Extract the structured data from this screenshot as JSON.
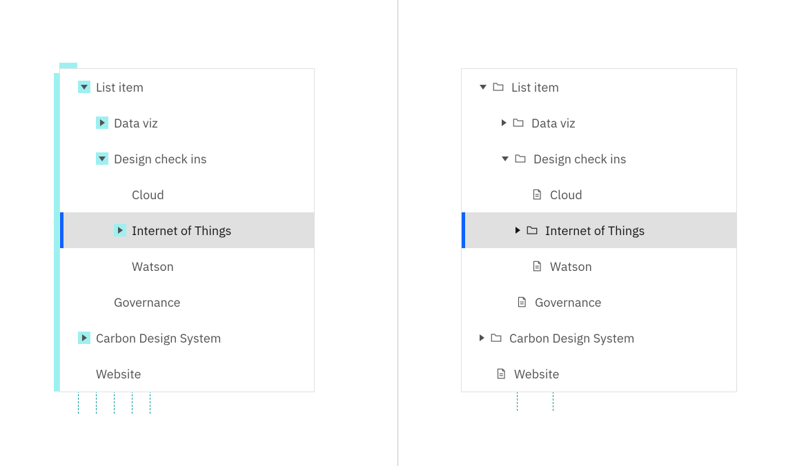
{
  "left": {
    "items": {
      "list_item": "List item",
      "data_viz": "Data viz",
      "design_check_ins": "Design check ins",
      "cloud": "Cloud",
      "iot": "Internet of Things",
      "watson": "Watson",
      "governance": "Governance",
      "carbon": "Carbon Design System",
      "website": "Website"
    }
  },
  "right": {
    "items": {
      "list_item": "List item",
      "data_viz": "Data viz",
      "design_check_ins": "Design check ins",
      "cloud": "Cloud",
      "iot": "Internet of Things",
      "watson": "Watson",
      "governance": "Governance",
      "carbon": "Carbon Design System",
      "website": "Website"
    }
  }
}
